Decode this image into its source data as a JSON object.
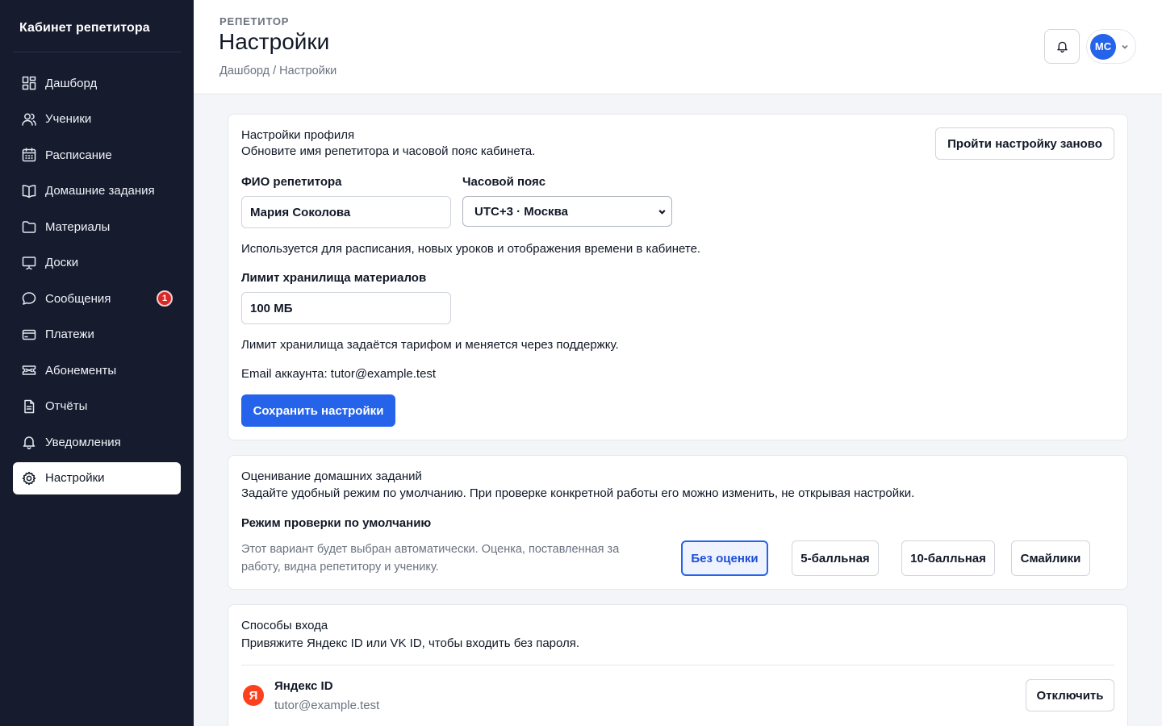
{
  "sidebar": {
    "brand": "Кабинет репетитора",
    "items": [
      {
        "label": "Дашборд",
        "icon": "dashboard-icon"
      },
      {
        "label": "Ученики",
        "icon": "users-icon"
      },
      {
        "label": "Расписание",
        "icon": "calendar-icon"
      },
      {
        "label": "Домашние задания",
        "icon": "book-icon"
      },
      {
        "label": "Материалы",
        "icon": "folder-icon"
      },
      {
        "label": "Доски",
        "icon": "board-icon"
      },
      {
        "label": "Сообщения",
        "icon": "chat-icon",
        "badge": "1"
      },
      {
        "label": "Платежи",
        "icon": "card-icon"
      },
      {
        "label": "Абонементы",
        "icon": "ticket-icon"
      },
      {
        "label": "Отчёты",
        "icon": "report-icon"
      },
      {
        "label": "Уведомления",
        "icon": "bell-icon"
      },
      {
        "label": "Настройки",
        "icon": "gear-icon",
        "active": true
      }
    ]
  },
  "header": {
    "eyebrow": "РЕПЕТИТОР",
    "title": "Настройки",
    "breadcrumb": "Дашборд / Настройки",
    "avatar_initials": "МС"
  },
  "profile": {
    "title": "Настройки профиля",
    "subtitle": "Обновите имя репетитора и часовой пояс кабинета.",
    "restart_button": "Пройти настройку заново",
    "name_label": "ФИО репетитора",
    "name_value": "Мария Соколова",
    "tz_label": "Часовой пояс",
    "tz_value": "UTC+3 · Москва",
    "tz_hint": "Используется для расписания, новых уроков и отображения времени в кабинете.",
    "storage_label": "Лимит хранилища материалов",
    "storage_value": "100 МБ",
    "storage_hint": "Лимит хранилища задаётся тарифом и меняется через поддержку.",
    "email_line": "Email аккаунта: tutor@example.test",
    "save_button": "Сохранить настройки"
  },
  "grading": {
    "title": "Оценивание домашних заданий",
    "subtitle": "Задайте удобный режим по умолчанию. При проверке конкретной работы его можно изменить, не открывая настройки.",
    "mode_label": "Режим проверки по умолчанию",
    "hint": "Этот вариант будет выбран автоматически. Оценка, поставленная за работу, видна репетитору и ученику.",
    "options": [
      "Без оценки",
      "5-балльная",
      "10-балльная",
      "Смайлики"
    ],
    "selected": "Без оценки"
  },
  "login": {
    "title": "Способы входа",
    "subtitle": "Привяжите Яндекс ID или VK ID, чтобы входить без пароля.",
    "provider_logo": "Я",
    "provider_name": "Яндекс ID",
    "provider_account": "tutor@example.test",
    "disconnect_button": "Отключить"
  },
  "colors": {
    "sidebar_bg": "#161b2e",
    "accent": "#2563eb",
    "badge": "#dc2626",
    "yandex": "#fc3f1d"
  }
}
